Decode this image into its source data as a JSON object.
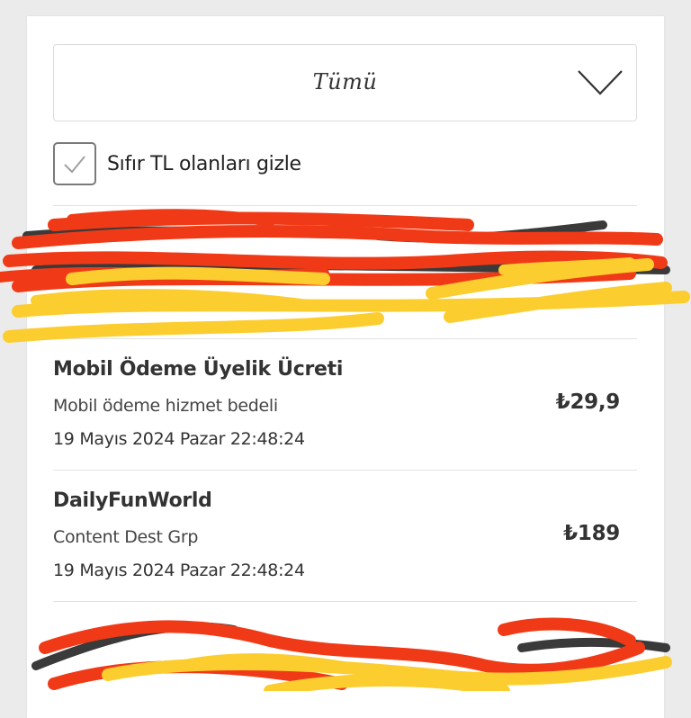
{
  "filter": {
    "selected": "Tümü"
  },
  "hide_zero": {
    "label": "Sıfır TL olanları gizle",
    "checked": true
  },
  "transactions": [
    {
      "title": "Mobil Ödeme Üyelik Ücreti",
      "description": "Mobil ödeme hizmet bedeli",
      "date": "19 Mayıs 2024 Pazar 22:48:24",
      "amount": "₺29,9"
    },
    {
      "title": "DailyFunWorld",
      "description": "Content Dest Grp",
      "date": "19 Mayıs 2024 Pazar 22:48:24",
      "amount": "₺189"
    }
  ],
  "colors": {
    "scribble_red": "#f03a17",
    "scribble_yellow": "#fccd2f",
    "scribble_dark": "#3a3a3a"
  }
}
